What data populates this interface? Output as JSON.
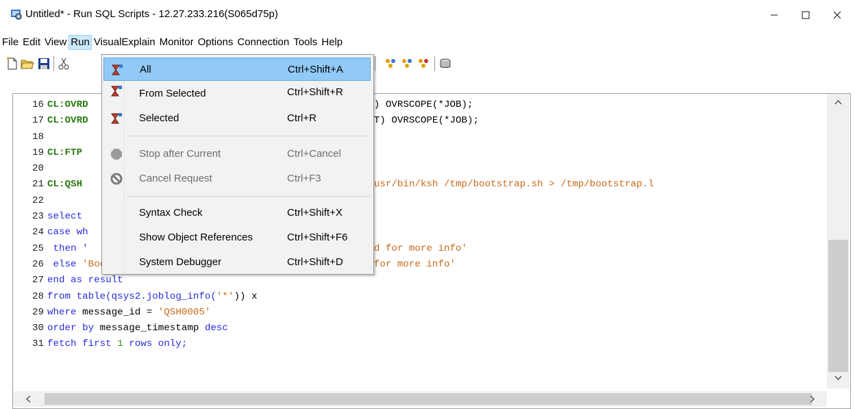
{
  "window": {
    "title": "Untitled* - Run SQL Scripts - 12.27.233.216(S065d75p)",
    "min_glyph": "—",
    "max_glyph": "☐",
    "close_glyph": "✕"
  },
  "menubar": {
    "items": [
      "File",
      "Edit",
      "View",
      "Run",
      "VisualExplain",
      "Monitor",
      "Options",
      "Connection",
      "Tools",
      "Help"
    ],
    "active": "Run"
  },
  "run_menu": {
    "items": [
      {
        "label": "All",
        "shortcut": "Ctrl+Shift+A",
        "icon": "run-all-icon",
        "enabled": true,
        "highlighted": true
      },
      {
        "label": "From Selected",
        "shortcut": "Ctrl+Shift+R",
        "icon": "run-from-selected-icon",
        "enabled": true
      },
      {
        "label": "Selected",
        "shortcut": "Ctrl+R",
        "icon": "run-selected-icon",
        "enabled": true
      },
      {
        "label": "Stop after Current",
        "shortcut": "Ctrl+Cancel",
        "icon": "stop-icon",
        "enabled": false
      },
      {
        "label": "Cancel Request",
        "shortcut": "Ctrl+F3",
        "icon": "cancel-icon",
        "enabled": false
      },
      {
        "label": "Syntax Check",
        "shortcut": "Ctrl+Shift+X",
        "enabled": true
      },
      {
        "label": "Show Object References",
        "shortcut": "Ctrl+Shift+F6",
        "enabled": true
      },
      {
        "label": "System Debugger",
        "shortcut": "Ctrl+Shift+D",
        "enabled": true
      }
    ]
  },
  "editor": {
    "lines": [
      {
        "n": "16",
        "segs": [
          {
            "t": "CL:OVRD",
            "c": "kw-green"
          },
          {
            "t": "                                       ",
            "c": "plain"
          },
          {
            "t": "MBR(*FIRST) OVRSCOPE(*JOB);",
            "c": "plain"
          }
        ]
      },
      {
        "n": "17",
        "segs": [
          {
            "t": "CL:OVRD",
            "c": "kw-green"
          },
          {
            "t": "                                        ",
            "c": "plain"
          },
          {
            "t": "MBR(*FIRST) OVRSCOPE(*JOB);",
            "c": "plain"
          }
        ]
      },
      {
        "n": "18",
        "segs": []
      },
      {
        "n": "19",
        "segs": [
          {
            "t": "CL:FTP",
            "c": "kw-green"
          }
        ]
      },
      {
        "n": "20",
        "segs": []
      },
      {
        "n": "21",
        "segs": [
          {
            "t": "CL:QSH",
            "c": "kw-green"
          },
          {
            "t": "                                      ",
            "c": "plain"
          },
          {
            "t": "; /QOpenSys/usr/bin/ksh /tmp/bootstrap.sh > /tmp/bootstrap.l",
            "c": "str"
          }
        ]
      },
      {
        "n": "22",
        "segs": []
      },
      {
        "n": "23",
        "segs": [
          {
            "t": "select",
            "c": "kw-blue"
          }
        ]
      },
      {
        "n": "24",
        "segs": [
          {
            "t": "case wh",
            "c": "kw-blue"
          }
        ]
      },
      {
        "n": "25",
        "segs": [
          {
            "t": " then '",
            "c": "kw-blue"
          },
          {
            "t": "                                       ",
            "c": "plain"
          },
          {
            "t": "p/README.md for more info'",
            "c": "str"
          }
        ]
      },
      {
        "n": "26",
        "segs": [
          {
            "t": " else ",
            "c": "kw-blue"
          },
          {
            "t": "'Bootstrapping failed. Consult /tmp/bootstrap.log for more info'",
            "c": "str"
          }
        ]
      },
      {
        "n": "27",
        "segs": [
          {
            "t": "end as result",
            "c": "kw-blue"
          }
        ]
      },
      {
        "n": "28",
        "segs": [
          {
            "t": "from ",
            "c": "kw-blue"
          },
          {
            "t": "table(qsys2.joblog_info(",
            "c": "kw-blue"
          },
          {
            "t": "'*'",
            "c": "str"
          },
          {
            "t": ")) x",
            "c": "plain"
          }
        ]
      },
      {
        "n": "29",
        "segs": [
          {
            "t": "where ",
            "c": "kw-blue"
          },
          {
            "t": "message_id = ",
            "c": "plain"
          },
          {
            "t": "'QSH0005'",
            "c": "str"
          }
        ]
      },
      {
        "n": "30",
        "segs": [
          {
            "t": "order by ",
            "c": "kw-blue"
          },
          {
            "t": "message_timestamp ",
            "c": "plain"
          },
          {
            "t": "desc",
            "c": "kw-blue"
          }
        ]
      },
      {
        "n": "31",
        "segs": [
          {
            "t": "fetch first ",
            "c": "kw-blue"
          },
          {
            "t": "1",
            "c": "num"
          },
          {
            "t": " rows only;",
            "c": "kw-blue"
          }
        ]
      }
    ]
  },
  "scroll": {
    "up": "^",
    "down": "v",
    "left": "<",
    "right": ">"
  }
}
